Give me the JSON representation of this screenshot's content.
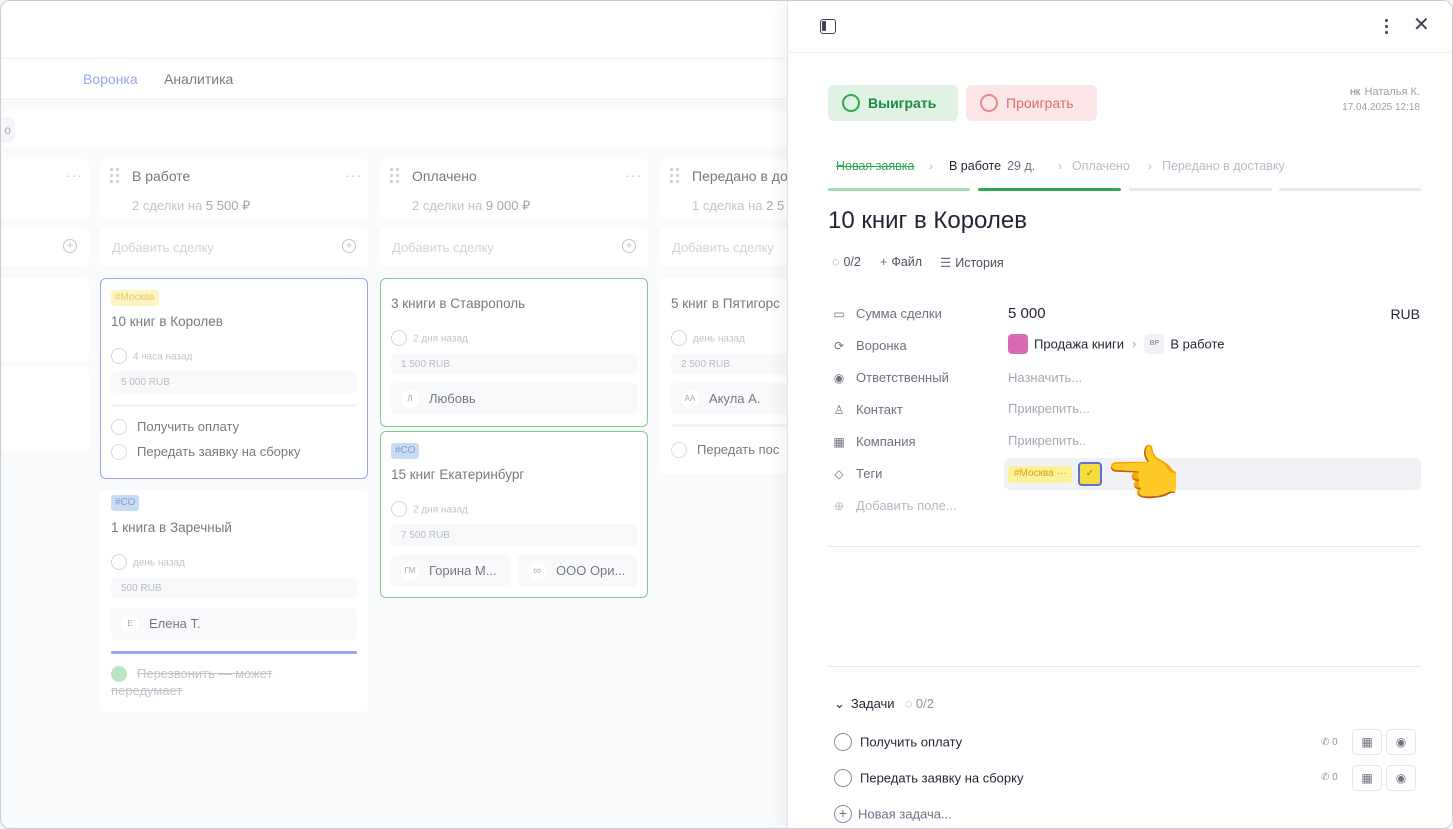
{
  "nav": {
    "funnel": "Воронка",
    "analytics": "Аналитика"
  },
  "filter_chip": "о",
  "columns": [
    {
      "title": "",
      "more": "···",
      "summary_prefix": "",
      "summary_value": "",
      "add_label": ""
    },
    {
      "title": "В работе",
      "more": "···",
      "summary_prefix": "2 сделки на",
      "summary_value": "5 500 ₽",
      "add_label": "Добавить сделку"
    },
    {
      "title": "Оплачено",
      "more": "···",
      "summary_prefix": "2 сделки на",
      "summary_value": "9 000 ₽",
      "add_label": "Добавить сделку"
    },
    {
      "title": "Передано в до",
      "more": "",
      "summary_prefix": "1 сделка на",
      "summary_value": "2 5",
      "add_label": "Добавить сделку"
    }
  ],
  "cards": {
    "korolev": {
      "tag": "#Москва",
      "title": "10 книг в Королев",
      "time": "4 часа назад",
      "sum": "5 000 RUB",
      "tasks": [
        "Получить оплату",
        "Передать заявку на сборку"
      ]
    },
    "zarechny": {
      "tag": "#СО",
      "title": "1 книга в Заречный",
      "time": "день назад",
      "sum": "500 RUB",
      "person_initial": "Е",
      "person": "Елена Т.",
      "done_task": "Перезвонить — может передумает"
    },
    "stavropol": {
      "title": "3 книги в Ставрополь",
      "time": "2 дня назад",
      "sum": "1 500 RUB",
      "person_initial": "Л",
      "person": "Любовь"
    },
    "ekb": {
      "tag": "#СО",
      "title": "15 книг Екатеринбург",
      "time": "2 дня назад",
      "sum": "7 500 RUB",
      "person_initial": "ГМ",
      "person": "Горина М...",
      "company_icon": "∞",
      "company": "ООО Ори..."
    },
    "pyatigorsk": {
      "title": "5 книг в Пятигорс",
      "time": "день назад",
      "sum": "2 500 RUB",
      "person_initial": "АА",
      "person": "Акула А.",
      "task": "Передать пос"
    }
  },
  "panel": {
    "win_label": "Выиграть",
    "lose_label": "Проиграть",
    "author_initials": "НК",
    "author_name": "Наталья К.",
    "author_date": "17.04.2025 12:18",
    "stages": {
      "new": "Новая заявка",
      "work": "В работе",
      "work_duration": "29 д.",
      "paid": "Оплачено",
      "delivery": "Передано в доставку"
    },
    "title": "10 книг в Королев",
    "quick": {
      "progress": "0/2",
      "file": "Файл",
      "history": "История"
    },
    "fields": {
      "amount_label": "Сумма сделки",
      "amount_value": "5 000",
      "currency": "RUB",
      "funnel_label": "Воронка",
      "funnel_value": "Продажа книги",
      "stage_initials": "ВР",
      "stage_value": "В работе",
      "responsible_label": "Ответственный",
      "responsible_value": "Назначить...",
      "contact_label": "Контакт",
      "contact_value": "Прикрепить...",
      "company_label": "Компания",
      "company_value": "Прикрепить..",
      "tags_label": "Теги",
      "tag_value": "#Москва",
      "tag_more": "···",
      "add_field": "Добавить поле..."
    },
    "tasks": {
      "header": "Задачи",
      "count": "0/2",
      "items": [
        {
          "label": "Получить оплату",
          "calls": "0"
        },
        {
          "label": "Передать заявку на сборку",
          "calls": "0"
        }
      ],
      "new_task": "Новая задача..."
    }
  },
  "colors": {
    "accent": "#5b6fe0",
    "green": "#2faa4f",
    "red": "#e06a6a",
    "tag_yellow": "#fdf19a",
    "tag_blue": "#a6c8ee"
  }
}
